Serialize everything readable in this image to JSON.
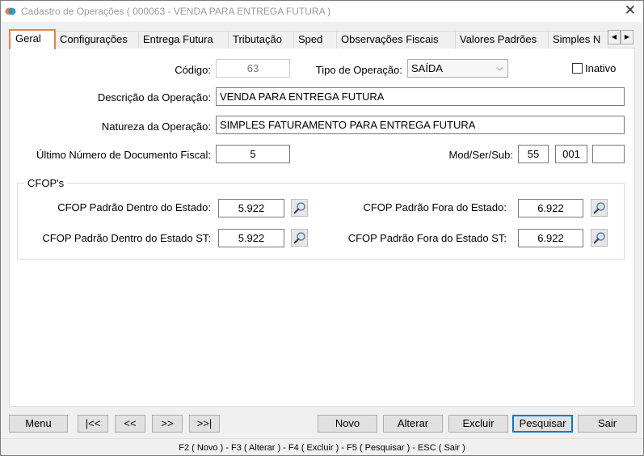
{
  "window": {
    "title": "Cadastro de Operações ( 000063 - VENDA PARA ENTREGA FUTURA )",
    "close_symbol": "✕"
  },
  "tabs": [
    {
      "label": "Geral",
      "active": true
    },
    {
      "label": "Configurações"
    },
    {
      "label": "Entrega Futura"
    },
    {
      "label": "Tributação"
    },
    {
      "label": "Sped"
    },
    {
      "label": "Observações Fiscais"
    },
    {
      "label": "Valores Padrões"
    },
    {
      "label": "Simples N"
    }
  ],
  "tab_scroll": {
    "left": "◀",
    "right": "▶"
  },
  "form": {
    "codigo_label": "Código:",
    "codigo_value": "63",
    "tipo_label": "Tipo de Operação:",
    "tipo_value": "SAÍDA",
    "inativo_label": "Inativo",
    "descricao_label": "Descrição da Operação:",
    "descricao_value": "VENDA PARA ENTREGA FUTURA",
    "natureza_label": "Natureza da Operação:",
    "natureza_value": "SIMPLES FATURAMENTO PARA ENTREGA FUTURA",
    "ultimo_label": "Último Número de Documento Fiscal:",
    "ultimo_value": "5",
    "modsersub_label": "Mod/Ser/Sub:",
    "mod_value": "55",
    "ser_value": "001",
    "sub_value": ""
  },
  "cfop": {
    "group_title": "CFOP's",
    "dentro_label": "CFOP Padrão Dentro do Estado:",
    "dentro_value": "5.922",
    "fora_label": "CFOP Padrão Fora do Estado:",
    "fora_value": "6.922",
    "dentro_st_label": "CFOP Padrão Dentro do Estado ST:",
    "dentro_st_value": "5.922",
    "fora_st_label": "CFOP Padrão Fora do Estado ST:",
    "fora_st_value": "6.922"
  },
  "buttons": {
    "menu": "Menu",
    "first": "|<<",
    "prev": "<<",
    "next": ">>",
    "last": ">>|",
    "novo": "Novo",
    "alterar": "Alterar",
    "excluir": "Excluir",
    "pesquisar": "Pesquisar",
    "sair": "Sair"
  },
  "status_bar": "F2 ( Novo ) - F3 ( Alterar ) - F4 ( Excluir ) - F5 ( Pesquisar ) - ESC ( Sair )",
  "colors": {
    "active_tab_border": "#e8853e",
    "default_button_border": "#0078d7"
  }
}
